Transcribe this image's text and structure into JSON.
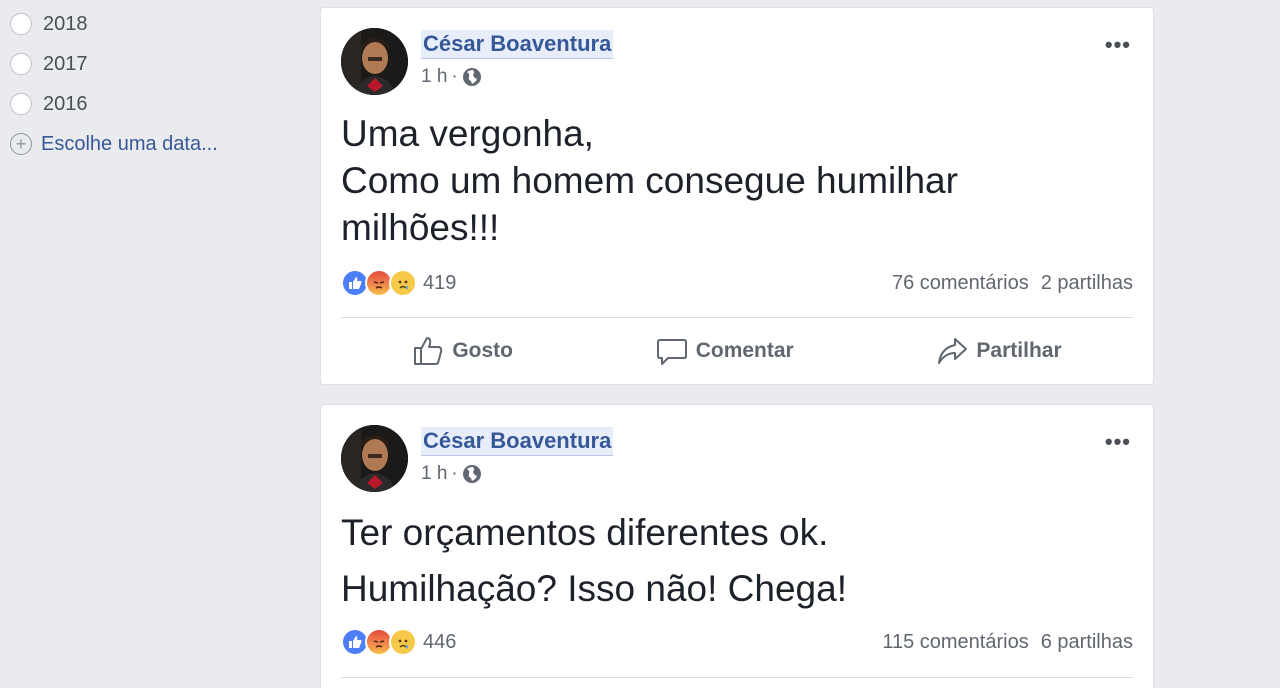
{
  "filter": {
    "years": [
      "2018",
      "2017",
      "2016"
    ],
    "pick_date_label": "Escolhe uma data..."
  },
  "posts": [
    {
      "author": "César Boaventura",
      "time": "1 h",
      "lines": [
        "Uma vergonha,",
        "Como um homem consegue humilhar",
        "milhões!!!"
      ],
      "reaction_count": "419",
      "comments": "76 comentários",
      "shares": "2 partilhas",
      "actions": {
        "like": "Gosto",
        "comment": "Comentar",
        "share": "Partilhar"
      }
    },
    {
      "author": "César Boaventura",
      "time": "1 h",
      "lines": [
        "Ter orçamentos diferentes ok.",
        "Humilhação? Isso não! Chega!"
      ],
      "reaction_count": "446",
      "comments": "115 comentários",
      "shares": "6 partilhas"
    }
  ],
  "colors": {
    "background": "#e9ebee",
    "link": "#385898",
    "author": "#365899",
    "like_reaction": "#4c7ef7"
  },
  "icons": {
    "reactions": [
      "like-reaction-icon",
      "angry-reaction-icon",
      "sad-reaction-icon"
    ],
    "privacy": "globe-icon",
    "menu": "more-options-icon"
  }
}
